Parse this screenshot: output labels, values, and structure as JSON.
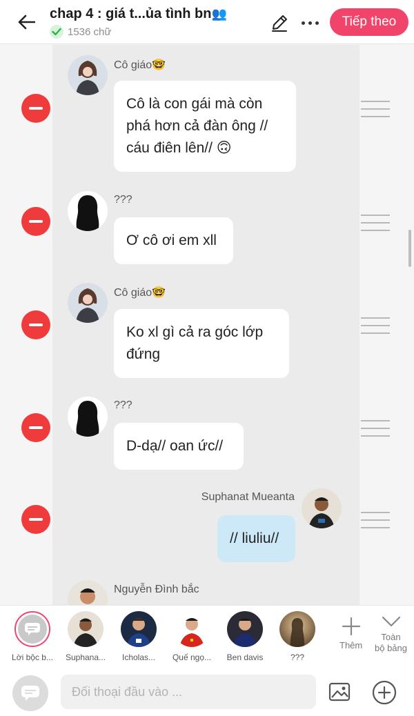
{
  "header": {
    "title": "chap 4 : giá t...ủa tình bn",
    "title_emoji": "👥",
    "word_count": "1536 chữ",
    "next_label": "Tiếp theo"
  },
  "messages": [
    {
      "speaker": "Cô giáo🤓",
      "text": "Cô là con gái mà còn phá hơn cả đàn ông // cáu điên lên// 🙃",
      "side": "left"
    },
    {
      "speaker": "???",
      "text": "Ơ cô ơi em xll",
      "side": "left"
    },
    {
      "speaker": "Cô giáo🤓",
      "text": "Ko xl gì cả ra góc lớp đứng",
      "side": "left"
    },
    {
      "speaker": "???",
      "text": "D-dạ// oan ức//",
      "side": "left"
    },
    {
      "speaker": "Suphanat Mueanta",
      "text": "// liuliu//",
      "side": "right"
    },
    {
      "speaker": "Nguyễn Đình bắc",
      "text": "",
      "side": "left"
    }
  ],
  "characters": [
    {
      "label": "Lời bộc b..."
    },
    {
      "label": "Suphana..."
    },
    {
      "label": "Icholas..."
    },
    {
      "label": "Quế ngọ..."
    },
    {
      "label": "Ben davis"
    },
    {
      "label": "???"
    }
  ],
  "bar_actions": {
    "more_label": "Thêm",
    "all_label_line1": "Toàn",
    "all_label_line2": "bộ bảng"
  },
  "input": {
    "placeholder": "Đối thoại đầu vào ..."
  },
  "colors": {
    "accent": "#f0446a",
    "remove": "#ef3b3b",
    "my_bubble": "#cde9f8"
  }
}
